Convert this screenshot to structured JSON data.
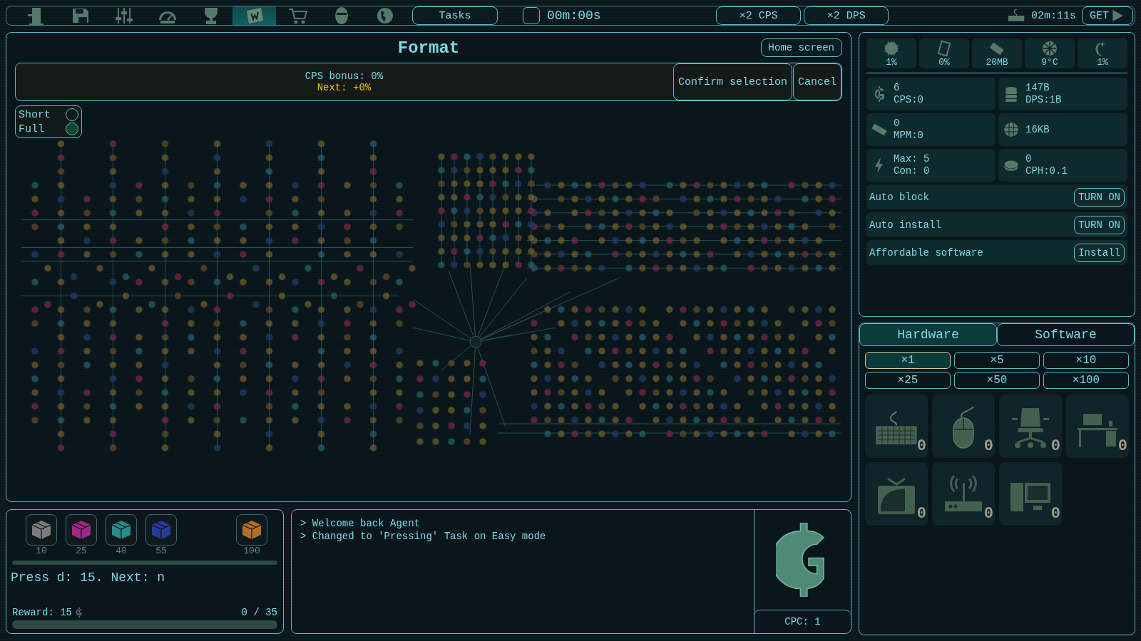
{
  "toolbar": {
    "buttons": [
      {
        "selected": false
      },
      {
        "selected": false
      },
      {
        "selected": false
      },
      {
        "selected": false
      },
      {
        "selected": false
      },
      {
        "selected": true
      },
      {
        "selected": false
      },
      {
        "selected": false
      },
      {
        "selected": false
      }
    ],
    "tasks_button": "Tasks",
    "task_timer": {
      "checked": false,
      "time": "00m:00s"
    },
    "boosts": [
      "×2 CPS",
      "×2 DPS"
    ],
    "bonus_timer": "02m:11s",
    "get_button": "GET"
  },
  "format_panel": {
    "title": "Format",
    "home_button": "Home screen",
    "bonus": "CPS bonus: 0%",
    "next": "Next: +0%",
    "confirm_button": "Confirm selection",
    "cancel_button": "Cancel",
    "modes": [
      {
        "label": "Short",
        "selected": false
      },
      {
        "label": "Full",
        "selected": true
      }
    ]
  },
  "system": {
    "sensors": [
      "1%",
      "0%",
      "20MB",
      "9°C",
      "1%"
    ],
    "stats": [
      {
        "lines": [
          "6",
          "CPS:0"
        ]
      },
      {
        "lines": [
          "147B",
          "DPS:1B"
        ]
      },
      {
        "lines": [
          "0",
          "MPM:0"
        ]
      },
      {
        "lines": [
          "16KB"
        ]
      },
      {
        "lines": [
          "Max: 5",
          "Con: 0"
        ]
      },
      {
        "lines": [
          "0",
          "CPH:0.1"
        ]
      }
    ],
    "toggles": [
      {
        "label": "Auto block",
        "button": "TURN ON"
      },
      {
        "label": "Auto install",
        "button": "TURN ON"
      },
      {
        "label": "Affordable software",
        "button": "Install"
      }
    ]
  },
  "shop": {
    "tabs": [
      {
        "label": "Hardware",
        "selected": true
      },
      {
        "label": "Software",
        "selected": false
      }
    ],
    "multipliers": [
      {
        "label": "×1",
        "selected": true
      },
      {
        "label": "×5",
        "selected": false
      },
      {
        "label": "×10",
        "selected": false
      },
      {
        "label": "×25",
        "selected": false
      },
      {
        "label": "×50",
        "selected": false
      },
      {
        "label": "×100",
        "selected": false
      }
    ],
    "hardware": [
      {
        "count": "0"
      },
      {
        "count": "0"
      },
      {
        "count": "0"
      },
      {
        "count": "0"
      },
      {
        "count": "0"
      },
      {
        "count": "0"
      },
      {
        "count": "0"
      }
    ]
  },
  "task": {
    "crates": [
      {
        "label": "10",
        "color": "#7c7c7c"
      },
      {
        "label": "25",
        "color": "#a0288a"
      },
      {
        "label": "40",
        "color": "#2a8a8e"
      },
      {
        "label": "55",
        "color": "#2a3a9a"
      },
      {
        "label": "100",
        "color": "#b0702a"
      }
    ],
    "prompt": "Press d: 15. Next: n",
    "reward": "Reward: 15",
    "progress": "0 / 35",
    "level": 0
  },
  "log": [
    "> Welcome back Agent",
    "> Changed to 'Pressing' Task on Easy mode"
  ],
  "cpc": "CPC: 1"
}
